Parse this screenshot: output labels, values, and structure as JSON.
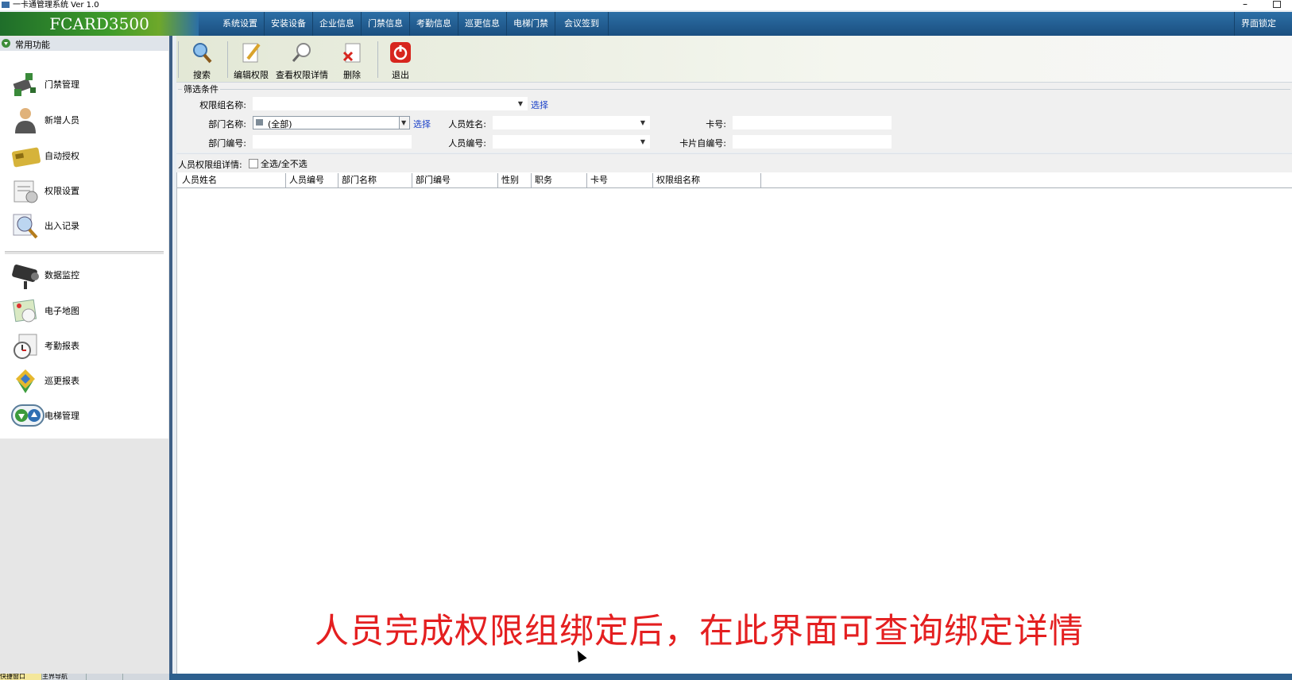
{
  "window": {
    "title": "一卡通管理系统  Ver 1.0",
    "minimize": "–"
  },
  "brand": "FCARD3500",
  "menu": {
    "items": [
      "系统设置",
      "安装设备",
      "企业信息",
      "门禁信息",
      "考勤信息",
      "巡更信息",
      "电梯门禁",
      "会议签到"
    ],
    "lock": "界面锁定"
  },
  "sidebar": {
    "header": "常用功能",
    "items": [
      {
        "label": "门禁管理",
        "icon": "door-control-icon"
      },
      {
        "label": "新增人员",
        "icon": "person-icon"
      },
      {
        "label": "自动授权",
        "icon": "card-icon"
      },
      {
        "label": "权限设置",
        "icon": "permission-icon"
      },
      {
        "label": "出入记录",
        "icon": "search-record-icon"
      },
      {
        "label": "数据监控",
        "icon": "camera-icon"
      },
      {
        "label": "电子地图",
        "icon": "map-icon"
      },
      {
        "label": "考勤报表",
        "icon": "clock-icon"
      },
      {
        "label": "巡更报表",
        "icon": "patrol-icon"
      },
      {
        "label": "电梯管理",
        "icon": "elevator-icon"
      }
    ],
    "bottom_tabs": [
      "快捷窗口",
      "主界导航",
      ""
    ]
  },
  "toolbar": {
    "search": "搜索",
    "edit": "编辑权限",
    "view": "查看权限详情",
    "delete": "删除",
    "exit": "退出"
  },
  "filter": {
    "legend": "筛选条件",
    "group_name_label": "权限组名称:",
    "group_name_value": "",
    "select_link": "选择",
    "dept_name_label": "部门名称:",
    "dept_name_value": "(全部)",
    "dept_select_link": "选择",
    "person_name_label": "人员姓名:",
    "card_no_label": "卡号:",
    "dept_code_label": "部门编号:",
    "person_code_label": "人员编号:",
    "card_self_code_label": "卡片自编号:"
  },
  "details": {
    "label": "人员权限组详情:",
    "select_all": "全选/全不选"
  },
  "grid": {
    "columns": [
      "人员姓名",
      "人员编号",
      "部门名称",
      "部门编号",
      "性别",
      "职务",
      "卡号",
      "权限组名称"
    ],
    "rows": []
  },
  "caption": "人员完成权限组绑定后，在此界面可查询绑定详情",
  "colors": {
    "menubar": "#1b4f80",
    "brand_green": "#3e9b2a",
    "link": "#1a40c8",
    "caption": "#e41f20",
    "exit_red": "#d7261e"
  }
}
